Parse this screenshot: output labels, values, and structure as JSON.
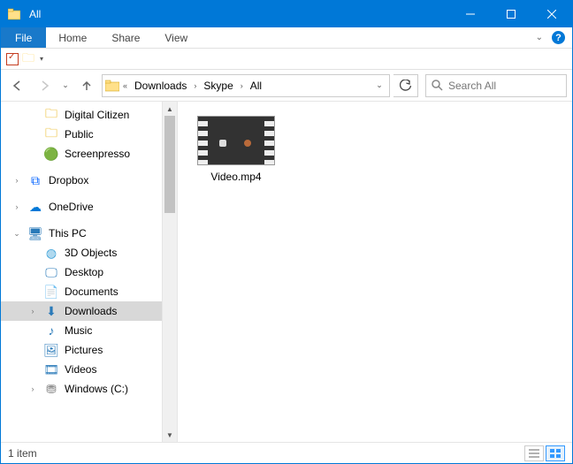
{
  "window": {
    "title": "All"
  },
  "ribbon": {
    "file": "File",
    "tabs": [
      "Home",
      "Share",
      "View"
    ]
  },
  "breadcrumb": {
    "items": [
      "Downloads",
      "Skype",
      "All"
    ]
  },
  "search": {
    "placeholder": "Search All"
  },
  "navpane": {
    "top_folders": [
      "Digital Citizen",
      "Public",
      "Screenpresso"
    ],
    "roots": [
      {
        "label": "Dropbox",
        "icon": "dropbox"
      },
      {
        "label": "OneDrive",
        "icon": "onedrive"
      },
      {
        "label": "This PC",
        "icon": "thispc",
        "expanded": true,
        "children": [
          {
            "label": "3D Objects",
            "icon": "3d"
          },
          {
            "label": "Desktop",
            "icon": "desktop"
          },
          {
            "label": "Documents",
            "icon": "documents"
          },
          {
            "label": "Downloads",
            "icon": "downloads",
            "selected": true
          },
          {
            "label": "Music",
            "icon": "music"
          },
          {
            "label": "Pictures",
            "icon": "pictures"
          },
          {
            "label": "Videos",
            "icon": "videos"
          },
          {
            "label": "Windows (C:)",
            "icon": "drive"
          }
        ]
      }
    ]
  },
  "content": {
    "files": [
      {
        "name": "Video.mp4",
        "type": "video"
      }
    ]
  },
  "status": {
    "text": "1 item"
  }
}
